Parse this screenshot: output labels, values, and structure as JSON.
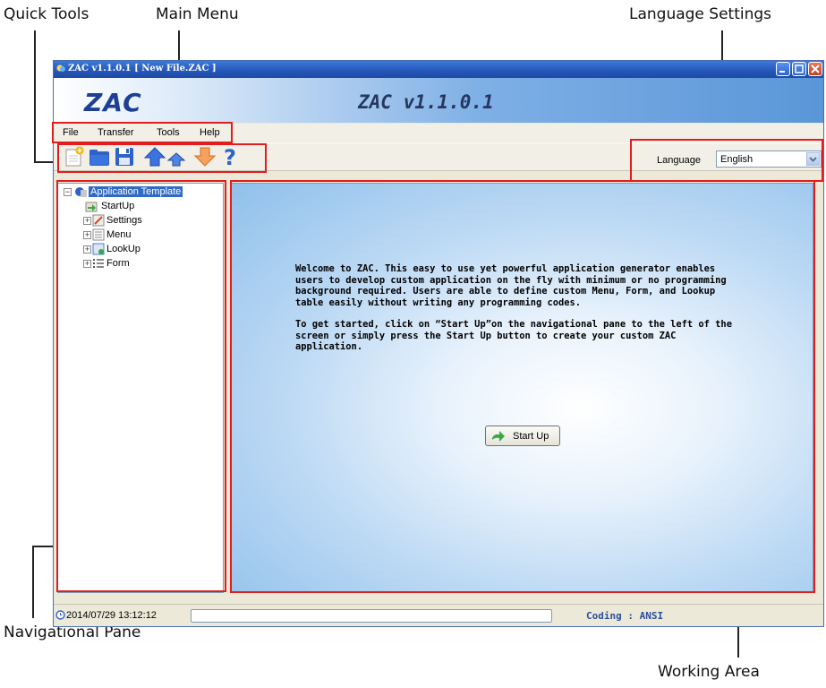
{
  "callouts": {
    "quick_tools": "Quick Tools",
    "main_menu": "Main Menu",
    "language_settings": "Language Settings",
    "navigational_pane": "Navigational Pane",
    "working_area": "Working Area"
  },
  "window": {
    "title": "ZAC v1.1.0.1 [ New File.ZAC ]",
    "logo": "ZAC",
    "version_banner": "ZAC v1.1.0.1"
  },
  "menu": [
    "File",
    "Transfer",
    "Tools",
    "Help"
  ],
  "toolbar": {
    "icons": [
      "new-file-icon",
      "open-folder-icon",
      "save-icon",
      "upload-icon",
      "upload-small-icon",
      "download-icon",
      "help-icon"
    ],
    "language_label": "Language",
    "language_value": "English"
  },
  "tree": {
    "root": "Application Template",
    "items": [
      "StartUp",
      "Settings",
      "Menu",
      "LookUp",
      "Form"
    ]
  },
  "work": {
    "welcome_p1": "Welcome to ZAC. This easy to use yet powerful application generator enables users to develop custom application on the fly with minimum or no programming background required. Users are able to define custom Menu, Form, and Lookup table easily without writing any programming codes.",
    "welcome_p2": "To get started, click on “Start Up”on the navigational pane to the left of the screen or simply press the Start Up button to create your custom ZAC application.",
    "start_button": "Start Up"
  },
  "status": {
    "datetime": "2014/07/29 13:12:12",
    "coding": "Coding : ANSI"
  },
  "colors": {
    "highlight_box": "#e11d1d",
    "title_bar": "#2456b8",
    "selection": "#316ac5"
  }
}
